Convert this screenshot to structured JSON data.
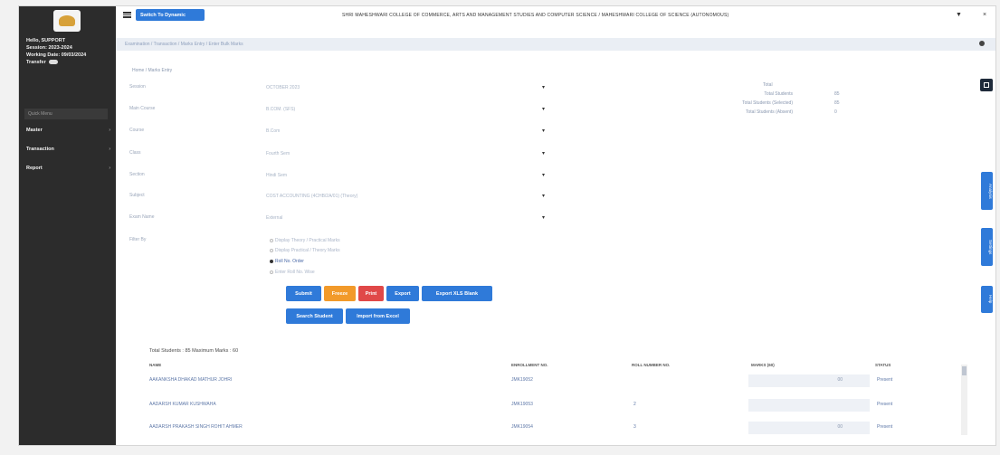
{
  "sidebar": {
    "info_lines": [
      "Hello, SUPPORT",
      "Session: 2023-2024",
      "Working Date: 09/03/2024"
    ],
    "theme_label": "Transfer",
    "quick_placeholder": "Quick Menu",
    "nav": [
      "Master",
      "Transaction",
      "Report"
    ]
  },
  "topbar": {
    "switch_label": "Switch To Dynamic",
    "college": "SHRI MAHESHWARI COLLEGE OF COMMERCE, ARTS AND MANAGEMENT STUDIES AND COMPUTER SCIENCE / MAHESHWARI COLLEGE OF SCIENCE (AUTONOMOUS)",
    "icons": [
      "bell-icon",
      "close-icon"
    ]
  },
  "breadcrumb": "Examination / Transaction / Marks Entry / Enter Bulk Marks",
  "page_title": "Home / Marks Entry",
  "form": {
    "fields": [
      {
        "label": "Session",
        "value": "OCTOBER 2023"
      },
      {
        "label": "Main Course",
        "value": "B.COM. (SFS)"
      },
      {
        "label": "Course",
        "value": "B.Com"
      },
      {
        "label": "Class",
        "value": "Fourth Sem"
      },
      {
        "label": "Section",
        "value": "Hindi Sem"
      },
      {
        "label": "Subject",
        "value": "COST ACCOUNTING (4CHB/2A/01) (Theory)"
      },
      {
        "label": "Exam Name",
        "value": "External"
      }
    ],
    "filter_label": "Filter By",
    "radios": [
      {
        "label": "Display Theory / Practical Marks",
        "selected": false
      },
      {
        "label": "Display Practical / Theory Marks",
        "selected": false
      },
      {
        "label": "Roll No. Order",
        "selected": true
      },
      {
        "label": "Enter Roll No. Wise",
        "selected": false
      }
    ],
    "buttons_row1": [
      "Submit",
      "Freeze",
      "Print",
      "Export",
      "Export XLS Blank"
    ],
    "buttons_row2": [
      "Search Student",
      "Import from Excel"
    ]
  },
  "totals": {
    "heading": "Total",
    "items": [
      {
        "label": "Total Students",
        "value": "85"
      },
      {
        "label": "Total Students (Selected)",
        "value": "85"
      },
      {
        "label": "Total Students (Absent)",
        "value": "0"
      }
    ]
  },
  "floating_tabs": [
    "Analysis",
    "Settings",
    "Help"
  ],
  "table": {
    "summary": "Total Students : 85   Maximum Marks : 60",
    "headers": [
      "NAME",
      "ENROLLMENT NO.",
      "ROLL NUMBER NO.",
      "MARKS (60)",
      "STATUS"
    ],
    "rows": [
      {
        "name": "AAKANKSHA DHAKAD MATHUR JOHRI",
        "enroll": "JMK19052",
        "roll": "",
        "marks": "00",
        "status": "Present"
      },
      {
        "name": "AADARSH KUMAR KUSHWAHA",
        "enroll": "JMK19053",
        "roll": "2",
        "marks": "",
        "status": "Present"
      },
      {
        "name": "AADARSH PRAKASH SINGH ROHIT AHMER",
        "enroll": "JMK19054",
        "roll": "3",
        "marks": "00",
        "status": "Present"
      }
    ]
  },
  "colors": {
    "accent": "#2f7ad9",
    "sidebar": "#2c2c2c",
    "warning": "#f29a2a",
    "danger": "#e04848"
  }
}
